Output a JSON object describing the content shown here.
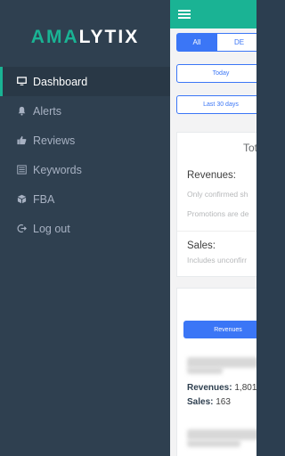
{
  "brand": {
    "part1": "AMA",
    "part2": "LYTIX"
  },
  "sidebar": {
    "items": [
      {
        "label": "Dashboard",
        "icon": "monitor-icon",
        "active": true
      },
      {
        "label": "Alerts",
        "icon": "bell-icon"
      },
      {
        "label": "Reviews",
        "icon": "thumbs-up-icon"
      },
      {
        "label": "Keywords",
        "icon": "list-icon"
      },
      {
        "label": "FBA",
        "icon": "cube-icon"
      },
      {
        "label": "Log out",
        "icon": "logout-icon"
      }
    ]
  },
  "main": {
    "tabs": [
      {
        "label": "All"
      },
      {
        "label": "DE"
      }
    ],
    "date_buttons": {
      "today": "Today",
      "last30": "Last 30 days"
    },
    "totals_card": {
      "title": "Tot",
      "revenues_label": "Revenues:",
      "revenues_note1": "Only confirmed sh",
      "revenues_note2": "Promotions are de",
      "sales_label": "Sales:",
      "sales_note": "Includes unconfirr"
    },
    "products_card": {
      "revenues_button": "Revenues",
      "revenues_key": "Revenues:",
      "revenues_value": "1,801.",
      "sales_key": "Sales:",
      "sales_value": "163"
    }
  },
  "colors": {
    "accent": "#1ab394",
    "primary": "#3b76f6",
    "sidebar_bg": "#2f4050"
  }
}
